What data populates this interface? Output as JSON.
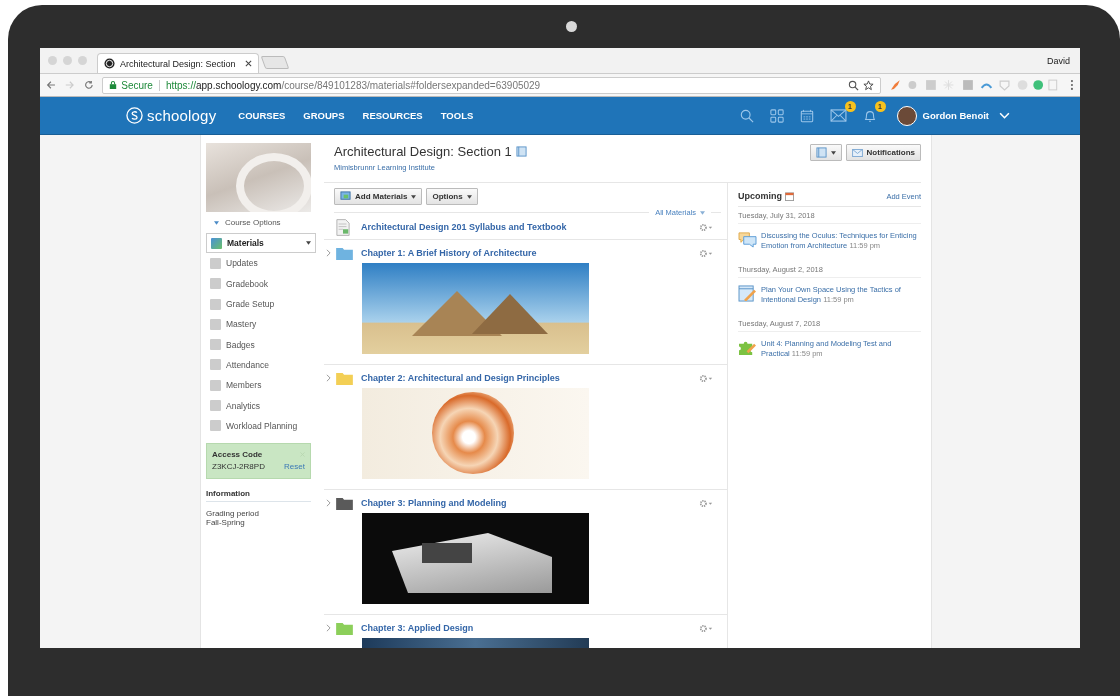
{
  "browser": {
    "tab_title": "Architectural Design: Section",
    "profile_name": "David",
    "secure_label": "Secure",
    "url_scheme": "https://",
    "url_host": "app.schoology.com",
    "url_path": "/course/849101283/materials#foldersexpanded=63905029"
  },
  "nav": {
    "logo": "schoology",
    "links": [
      "COURSES",
      "GROUPS",
      "RESOURCES",
      "TOOLS"
    ],
    "message_badge": "1",
    "notification_badge": "1",
    "user_name": "Gordon Benoit"
  },
  "sidebar": {
    "course_options": "Course Options",
    "items": [
      {
        "label": "Materials",
        "selected": true
      },
      {
        "label": "Updates",
        "selected": false
      },
      {
        "label": "Gradebook",
        "selected": false
      },
      {
        "label": "Grade Setup",
        "selected": false
      },
      {
        "label": "Mastery",
        "selected": false
      },
      {
        "label": "Badges",
        "selected": false
      },
      {
        "label": "Attendance",
        "selected": false
      },
      {
        "label": "Members",
        "selected": false
      },
      {
        "label": "Analytics",
        "selected": false
      },
      {
        "label": "Workload Planning",
        "selected": false
      }
    ],
    "access_code": {
      "title": "Access Code",
      "code": "Z3KCJ-2R8PD",
      "reset": "Reset"
    },
    "information": {
      "title": "Information",
      "lines": [
        "Grading period",
        "Fall-Spring"
      ]
    }
  },
  "course": {
    "title": "Architectural Design: Section 1",
    "institution": "Mimisbrunnr Learning Institute",
    "notifications_button": "Notifications",
    "add_materials": "Add Materials",
    "options": "Options",
    "filter": "All Materials",
    "materials": [
      {
        "kind": "document",
        "title": "Architectural Design 201 Syllabus and Textbook"
      },
      {
        "kind": "folder",
        "title": "Chapter 1: A Brief History of Architecture",
        "color": "#6fb3e0"
      },
      {
        "kind": "folder",
        "title": "Chapter 2: Architectural and Design Principles",
        "color": "#f3cf55"
      },
      {
        "kind": "folder",
        "title": "Chapter 3: Planning and Modeling",
        "color": "#5a5a5a"
      },
      {
        "kind": "folder",
        "title": "Chapter 3: Applied Design",
        "color": "#8ccf5a"
      }
    ]
  },
  "upcoming": {
    "title": "Upcoming",
    "add_event": "Add Event",
    "groups": [
      {
        "date": "Tuesday, July 31, 2018",
        "events": [
          {
            "kind": "discussion",
            "title": "Discussing the Oculus: Techniques for Enticing Emotion from Architecture",
            "time": "11:59 pm"
          }
        ]
      },
      {
        "date": "Thursday, August 2, 2018",
        "events": [
          {
            "kind": "assignment",
            "title": "Plan Your Own Space Using the Tactics of Intentional Design",
            "time": "11:59 pm"
          }
        ]
      },
      {
        "date": "Tuesday, August 7, 2018",
        "events": [
          {
            "kind": "assessment",
            "title": "Unit 4: Planning and Modeling Test and Practical",
            "time": "11:59 pm"
          }
        ]
      }
    ]
  }
}
